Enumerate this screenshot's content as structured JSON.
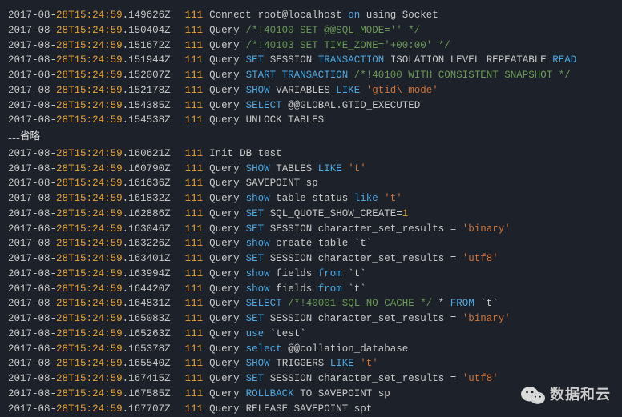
{
  "ellipsis_text": "……省略",
  "watermark_text": "数据和云",
  "block1": [
    {
      "date": "2017-08",
      "h": "28T15",
      "m": "24",
      "s": "59",
      "f": "149626Z",
      "id": "111",
      "type": "Connect",
      "tok": [
        {
          "c": "txt",
          "t": "root@localhost "
        },
        {
          "c": "kw",
          "t": "on"
        },
        {
          "c": "txt",
          "t": "  using Socket"
        }
      ]
    },
    {
      "date": "2017-08",
      "h": "28T15",
      "m": "24",
      "s": "59",
      "f": "150404Z",
      "id": "111",
      "type": "Query",
      "tok": [
        {
          "c": "cm",
          "t": "/*!40100 SET @@SQL_MODE='' */"
        }
      ]
    },
    {
      "date": "2017-08",
      "h": "28T15",
      "m": "24",
      "s": "59",
      "f": "151672Z",
      "id": "111",
      "type": "Query",
      "tok": [
        {
          "c": "cm",
          "t": "/*!40103 SET TIME_ZONE='+00:00' */"
        }
      ]
    },
    {
      "date": "2017-08",
      "h": "28T15",
      "m": "24",
      "s": "59",
      "f": "151944Z",
      "id": "111",
      "type": "Query",
      "tok": [
        {
          "c": "kw",
          "t": "SET"
        },
        {
          "c": "txt",
          "t": " SESSION "
        },
        {
          "c": "kw",
          "t": "TRANSACTION"
        },
        {
          "c": "txt",
          "t": " ISOLATION LEVEL REPEATABLE "
        },
        {
          "c": "kw",
          "t": "READ"
        }
      ]
    },
    {
      "date": "2017-08",
      "h": "28T15",
      "m": "24",
      "s": "59",
      "f": "152007Z",
      "id": "111",
      "type": "Query",
      "tok": [
        {
          "c": "kw",
          "t": "START TRANSACTION"
        },
        {
          "c": "txt",
          "t": " "
        },
        {
          "c": "cm",
          "t": "/*!40100 WITH CONSISTENT SNAPSHOT */"
        }
      ]
    },
    {
      "date": "2017-08",
      "h": "28T15",
      "m": "24",
      "s": "59",
      "f": "152178Z",
      "id": "111",
      "type": "Query",
      "tok": [
        {
          "c": "kw",
          "t": "SHOW"
        },
        {
          "c": "txt",
          "t": " VARIABLES "
        },
        {
          "c": "kw",
          "t": "LIKE"
        },
        {
          "c": "txt",
          "t": " "
        },
        {
          "c": "str",
          "t": "'gtid\\_mode'"
        }
      ]
    },
    {
      "date": "2017-08",
      "h": "28T15",
      "m": "24",
      "s": "59",
      "f": "154385Z",
      "id": "111",
      "type": "Query",
      "tok": [
        {
          "c": "kw",
          "t": "SELECT"
        },
        {
          "c": "txt",
          "t": " @@GLOBAL.GTID_EXECUTED"
        }
      ]
    },
    {
      "date": "2017-08",
      "h": "28T15",
      "m": "24",
      "s": "59",
      "f": "154538Z",
      "id": "111",
      "type": "Query",
      "tok": [
        {
          "c": "txt",
          "t": "UNLOCK TABLES"
        }
      ]
    }
  ],
  "block2": [
    {
      "date": "2017-08",
      "h": "28T15",
      "m": "24",
      "s": "59",
      "f": "160621Z",
      "id": "111",
      "type": "Init",
      "tok": [
        {
          "c": "txt",
          "t": "DB test"
        }
      ]
    },
    {
      "date": "2017-08",
      "h": "28T15",
      "m": "24",
      "s": "59",
      "f": "160790Z",
      "id": "111",
      "type": "Query",
      "tok": [
        {
          "c": "kw",
          "t": "SHOW"
        },
        {
          "c": "txt",
          "t": " TABLES "
        },
        {
          "c": "kw",
          "t": "LIKE"
        },
        {
          "c": "txt",
          "t": " "
        },
        {
          "c": "str",
          "t": "'t'"
        }
      ]
    },
    {
      "date": "2017-08",
      "h": "28T15",
      "m": "24",
      "s": "59",
      "f": "161636Z",
      "id": "111",
      "type": "Query",
      "tok": [
        {
          "c": "txt",
          "t": "SAVEPOINT sp"
        }
      ]
    },
    {
      "date": "2017-08",
      "h": "28T15",
      "m": "24",
      "s": "59",
      "f": "161832Z",
      "id": "111",
      "type": "Query",
      "tok": [
        {
          "c": "kw",
          "t": "show"
        },
        {
          "c": "txt",
          "t": " table status "
        },
        {
          "c": "kw",
          "t": "like"
        },
        {
          "c": "txt",
          "t": " "
        },
        {
          "c": "str",
          "t": "'t'"
        }
      ]
    },
    {
      "date": "2017-08",
      "h": "28T15",
      "m": "24",
      "s": "59",
      "f": "162886Z",
      "id": "111",
      "type": "Query",
      "tok": [
        {
          "c": "kw",
          "t": "SET"
        },
        {
          "c": "txt",
          "t": " SQL_QUOTE_SHOW_CREATE="
        },
        {
          "c": "num",
          "t": "1"
        }
      ]
    },
    {
      "date": "2017-08",
      "h": "28T15",
      "m": "24",
      "s": "59",
      "f": "163046Z",
      "id": "111",
      "type": "Query",
      "tok": [
        {
          "c": "kw",
          "t": "SET"
        },
        {
          "c": "txt",
          "t": " SESSION character_set_results = "
        },
        {
          "c": "str",
          "t": "'binary'"
        }
      ]
    },
    {
      "date": "2017-08",
      "h": "28T15",
      "m": "24",
      "s": "59",
      "f": "163226Z",
      "id": "111",
      "type": "Query",
      "tok": [
        {
          "c": "kw",
          "t": "show"
        },
        {
          "c": "txt",
          "t": " create table `t`"
        }
      ]
    },
    {
      "date": "2017-08",
      "h": "28T15",
      "m": "24",
      "s": "59",
      "f": "163401Z",
      "id": "111",
      "type": "Query",
      "tok": [
        {
          "c": "kw",
          "t": "SET"
        },
        {
          "c": "txt",
          "t": " SESSION character_set_results = "
        },
        {
          "c": "str",
          "t": "'utf8'"
        }
      ]
    },
    {
      "date": "2017-08",
      "h": "28T15",
      "m": "24",
      "s": "59",
      "f": "163994Z",
      "id": "111",
      "type": "Query",
      "tok": [
        {
          "c": "kw",
          "t": "show"
        },
        {
          "c": "txt",
          "t": " fields "
        },
        {
          "c": "kw",
          "t": "from"
        },
        {
          "c": "txt",
          "t": " `t`"
        }
      ]
    },
    {
      "date": "2017-08",
      "h": "28T15",
      "m": "24",
      "s": "59",
      "f": "164420Z",
      "id": "111",
      "type": "Query",
      "tok": [
        {
          "c": "kw",
          "t": "show"
        },
        {
          "c": "txt",
          "t": " fields "
        },
        {
          "c": "kw",
          "t": "from"
        },
        {
          "c": "txt",
          "t": " `t`"
        }
      ]
    },
    {
      "date": "2017-08",
      "h": "28T15",
      "m": "24",
      "s": "59",
      "f": "164831Z",
      "id": "111",
      "type": "Query",
      "tok": [
        {
          "c": "kw",
          "t": "SELECT"
        },
        {
          "c": "txt",
          "t": " "
        },
        {
          "c": "cm",
          "t": "/*!40001 SQL_NO_CACHE */"
        },
        {
          "c": "txt",
          "t": " * "
        },
        {
          "c": "kw",
          "t": "FROM"
        },
        {
          "c": "txt",
          "t": " `t`"
        }
      ]
    },
    {
      "date": "2017-08",
      "h": "28T15",
      "m": "24",
      "s": "59",
      "f": "165083Z",
      "id": "111",
      "type": "Query",
      "tok": [
        {
          "c": "kw",
          "t": "SET"
        },
        {
          "c": "txt",
          "t": " SESSION character_set_results = "
        },
        {
          "c": "str",
          "t": "'binary'"
        }
      ]
    },
    {
      "date": "2017-08",
      "h": "28T15",
      "m": "24",
      "s": "59",
      "f": "165263Z",
      "id": "111",
      "type": "Query",
      "tok": [
        {
          "c": "kw",
          "t": "use"
        },
        {
          "c": "txt",
          "t": " `test`"
        }
      ]
    },
    {
      "date": "2017-08",
      "h": "28T15",
      "m": "24",
      "s": "59",
      "f": "165378Z",
      "id": "111",
      "type": "Query",
      "tok": [
        {
          "c": "kw",
          "t": "select"
        },
        {
          "c": "txt",
          "t": " @@collation_database"
        }
      ]
    },
    {
      "date": "2017-08",
      "h": "28T15",
      "m": "24",
      "s": "59",
      "f": "165540Z",
      "id": "111",
      "type": "Query",
      "tok": [
        {
          "c": "kw",
          "t": "SHOW"
        },
        {
          "c": "txt",
          "t": " TRIGGERS "
        },
        {
          "c": "kw",
          "t": "LIKE"
        },
        {
          "c": "txt",
          "t": " "
        },
        {
          "c": "str",
          "t": "'t'"
        }
      ]
    },
    {
      "date": "2017-08",
      "h": "28T15",
      "m": "24",
      "s": "59",
      "f": "167415Z",
      "id": "111",
      "type": "Query",
      "tok": [
        {
          "c": "kw",
          "t": "SET"
        },
        {
          "c": "txt",
          "t": " SESSION character_set_results = "
        },
        {
          "c": "str",
          "t": "'utf8'"
        }
      ]
    },
    {
      "date": "2017-08",
      "h": "28T15",
      "m": "24",
      "s": "59",
      "f": "167585Z",
      "id": "111",
      "type": "Query",
      "tok": [
        {
          "c": "kw",
          "t": "ROLLBACK"
        },
        {
          "c": "txt",
          "t": " TO SAVEPOINT sp"
        }
      ]
    },
    {
      "date": "2017-08",
      "h": "28T15",
      "m": "24",
      "s": "59",
      "f": "167707Z",
      "id": "111",
      "type": "Query",
      "tok": [
        {
          "c": "txt",
          "t": "RELEASE SAVEPOINT spt"
        }
      ]
    }
  ]
}
